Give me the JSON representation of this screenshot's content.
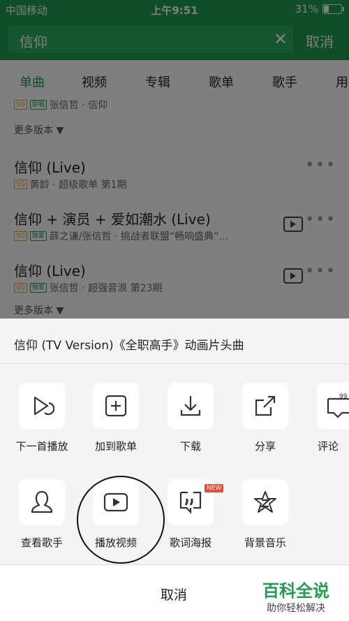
{
  "status_bar": {
    "carrier": "中国移动",
    "time": "上午9:51",
    "battery": "31%"
  },
  "search": {
    "query": "信仰",
    "cancel": "取消"
  },
  "tabs": [
    "单曲",
    "视频",
    "专辑",
    "歌单",
    "歌手",
    "用"
  ],
  "list": {
    "top_partial_sub": "张信哲 · 信仰",
    "more_versions": "更多版本 ▼",
    "items": [
      {
        "title": "信仰 (Live)",
        "sub": "黄龄 · 超级歌单 第1期"
      },
      {
        "title": "信仰 + 演员 + 爱如潮水 (Live)",
        "sub": "薛之谦/张信哲 · 挑战者联盟“畅响盛典”…"
      },
      {
        "title": "信仰 (Live)",
        "sub": "张信哲 · 超强音浪 第23期"
      }
    ],
    "more_versions_bottom": "更多版本 ▼"
  },
  "sheet": {
    "title": "信仰 (TV Version)《全职高手》动画片头曲",
    "row1": [
      "下一首播放",
      "加到歌单",
      "下载",
      "分享",
      "评论"
    ],
    "row2": [
      "查看歌手",
      "播放视频",
      "歌词海报",
      "背景音乐"
    ],
    "new_badge": "NEW",
    "cancel": "取消"
  },
  "watermark": {
    "brand": "百科全说",
    "tagline": "助你轻松解决"
  },
  "tags": {
    "sq": "SQ",
    "yuan": "原唱",
    "du": "独家"
  }
}
